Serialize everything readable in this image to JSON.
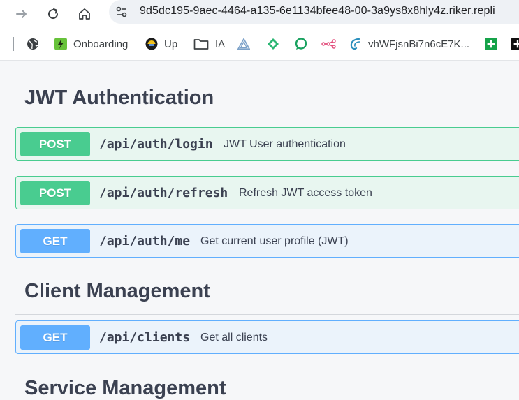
{
  "browser": {
    "url": "9d5dc195-9aec-4464-a135-6e1134bfee48-00-3a9ys8x8hly4z.riker.repli",
    "bookmarks": [
      {
        "label": "",
        "icon": "globe-icon"
      },
      {
        "label": "Onboarding",
        "icon": "lightning-icon"
      },
      {
        "label": "Up",
        "icon": "helmet-icon"
      },
      {
        "label": "IA",
        "icon": "folder-icon"
      },
      {
        "label": "",
        "icon": "triangle-logo-icon"
      },
      {
        "label": "",
        "icon": "diamond-logo-icon"
      },
      {
        "label": "",
        "icon": "chat-bubble-icon"
      },
      {
        "label": "",
        "icon": "nodes-icon"
      },
      {
        "label": "vhWFjsnBi7n6cE7K...",
        "icon": "wave-logo-icon"
      },
      {
        "label": "",
        "icon": "green-plus-icon"
      },
      {
        "label": "",
        "icon": "black-plus-icon"
      }
    ]
  },
  "colors": {
    "post": "#49cc90",
    "get": "#61affe",
    "text": "#3b4151"
  },
  "sections": [
    {
      "title": "JWT Authentication",
      "operations": [
        {
          "method": "POST",
          "path": "/api/auth/login",
          "summary": "JWT User authentication"
        },
        {
          "method": "POST",
          "path": "/api/auth/refresh",
          "summary": "Refresh JWT access token"
        },
        {
          "method": "GET",
          "path": "/api/auth/me",
          "summary": "Get current user profile (JWT)"
        }
      ]
    },
    {
      "title": "Client Management",
      "operations": [
        {
          "method": "GET",
          "path": "/api/clients",
          "summary": "Get all clients"
        }
      ]
    },
    {
      "title": "Service Management",
      "operations": []
    }
  ]
}
